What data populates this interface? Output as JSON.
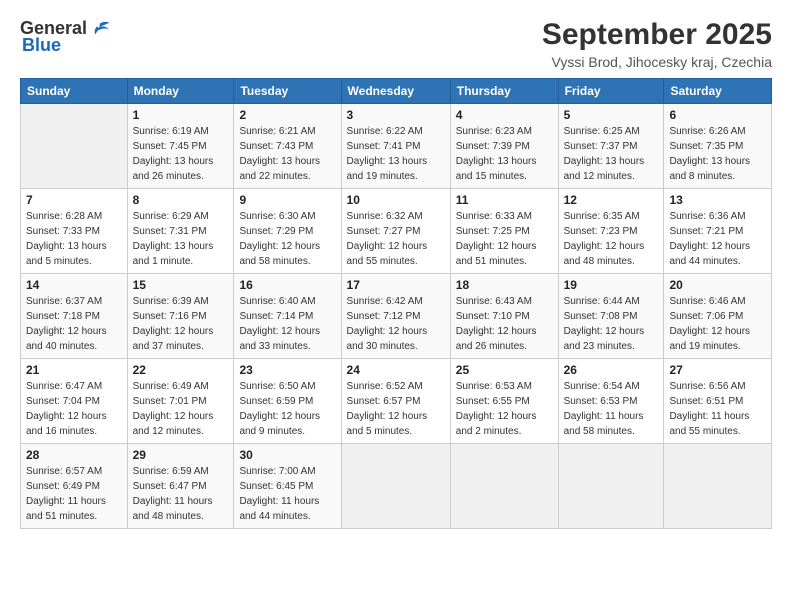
{
  "header": {
    "logo_general": "General",
    "logo_blue": "Blue",
    "title": "September 2025",
    "subtitle": "Vyssi Brod, Jihocesky kraj, Czechia"
  },
  "columns": [
    "Sunday",
    "Monday",
    "Tuesday",
    "Wednesday",
    "Thursday",
    "Friday",
    "Saturday"
  ],
  "weeks": [
    [
      {
        "day": "",
        "info": ""
      },
      {
        "day": "1",
        "info": "Sunrise: 6:19 AM\nSunset: 7:45 PM\nDaylight: 13 hours\nand 26 minutes."
      },
      {
        "day": "2",
        "info": "Sunrise: 6:21 AM\nSunset: 7:43 PM\nDaylight: 13 hours\nand 22 minutes."
      },
      {
        "day": "3",
        "info": "Sunrise: 6:22 AM\nSunset: 7:41 PM\nDaylight: 13 hours\nand 19 minutes."
      },
      {
        "day": "4",
        "info": "Sunrise: 6:23 AM\nSunset: 7:39 PM\nDaylight: 13 hours\nand 15 minutes."
      },
      {
        "day": "5",
        "info": "Sunrise: 6:25 AM\nSunset: 7:37 PM\nDaylight: 13 hours\nand 12 minutes."
      },
      {
        "day": "6",
        "info": "Sunrise: 6:26 AM\nSunset: 7:35 PM\nDaylight: 13 hours\nand 8 minutes."
      }
    ],
    [
      {
        "day": "7",
        "info": "Sunrise: 6:28 AM\nSunset: 7:33 PM\nDaylight: 13 hours\nand 5 minutes."
      },
      {
        "day": "8",
        "info": "Sunrise: 6:29 AM\nSunset: 7:31 PM\nDaylight: 13 hours\nand 1 minute."
      },
      {
        "day": "9",
        "info": "Sunrise: 6:30 AM\nSunset: 7:29 PM\nDaylight: 12 hours\nand 58 minutes."
      },
      {
        "day": "10",
        "info": "Sunrise: 6:32 AM\nSunset: 7:27 PM\nDaylight: 12 hours\nand 55 minutes."
      },
      {
        "day": "11",
        "info": "Sunrise: 6:33 AM\nSunset: 7:25 PM\nDaylight: 12 hours\nand 51 minutes."
      },
      {
        "day": "12",
        "info": "Sunrise: 6:35 AM\nSunset: 7:23 PM\nDaylight: 12 hours\nand 48 minutes."
      },
      {
        "day": "13",
        "info": "Sunrise: 6:36 AM\nSunset: 7:21 PM\nDaylight: 12 hours\nand 44 minutes."
      }
    ],
    [
      {
        "day": "14",
        "info": "Sunrise: 6:37 AM\nSunset: 7:18 PM\nDaylight: 12 hours\nand 40 minutes."
      },
      {
        "day": "15",
        "info": "Sunrise: 6:39 AM\nSunset: 7:16 PM\nDaylight: 12 hours\nand 37 minutes."
      },
      {
        "day": "16",
        "info": "Sunrise: 6:40 AM\nSunset: 7:14 PM\nDaylight: 12 hours\nand 33 minutes."
      },
      {
        "day": "17",
        "info": "Sunrise: 6:42 AM\nSunset: 7:12 PM\nDaylight: 12 hours\nand 30 minutes."
      },
      {
        "day": "18",
        "info": "Sunrise: 6:43 AM\nSunset: 7:10 PM\nDaylight: 12 hours\nand 26 minutes."
      },
      {
        "day": "19",
        "info": "Sunrise: 6:44 AM\nSunset: 7:08 PM\nDaylight: 12 hours\nand 23 minutes."
      },
      {
        "day": "20",
        "info": "Sunrise: 6:46 AM\nSunset: 7:06 PM\nDaylight: 12 hours\nand 19 minutes."
      }
    ],
    [
      {
        "day": "21",
        "info": "Sunrise: 6:47 AM\nSunset: 7:04 PM\nDaylight: 12 hours\nand 16 minutes."
      },
      {
        "day": "22",
        "info": "Sunrise: 6:49 AM\nSunset: 7:01 PM\nDaylight: 12 hours\nand 12 minutes."
      },
      {
        "day": "23",
        "info": "Sunrise: 6:50 AM\nSunset: 6:59 PM\nDaylight: 12 hours\nand 9 minutes."
      },
      {
        "day": "24",
        "info": "Sunrise: 6:52 AM\nSunset: 6:57 PM\nDaylight: 12 hours\nand 5 minutes."
      },
      {
        "day": "25",
        "info": "Sunrise: 6:53 AM\nSunset: 6:55 PM\nDaylight: 12 hours\nand 2 minutes."
      },
      {
        "day": "26",
        "info": "Sunrise: 6:54 AM\nSunset: 6:53 PM\nDaylight: 11 hours\nand 58 minutes."
      },
      {
        "day": "27",
        "info": "Sunrise: 6:56 AM\nSunset: 6:51 PM\nDaylight: 11 hours\nand 55 minutes."
      }
    ],
    [
      {
        "day": "28",
        "info": "Sunrise: 6:57 AM\nSunset: 6:49 PM\nDaylight: 11 hours\nand 51 minutes."
      },
      {
        "day": "29",
        "info": "Sunrise: 6:59 AM\nSunset: 6:47 PM\nDaylight: 11 hours\nand 48 minutes."
      },
      {
        "day": "30",
        "info": "Sunrise: 7:00 AM\nSunset: 6:45 PM\nDaylight: 11 hours\nand 44 minutes."
      },
      {
        "day": "",
        "info": ""
      },
      {
        "day": "",
        "info": ""
      },
      {
        "day": "",
        "info": ""
      },
      {
        "day": "",
        "info": ""
      }
    ]
  ]
}
